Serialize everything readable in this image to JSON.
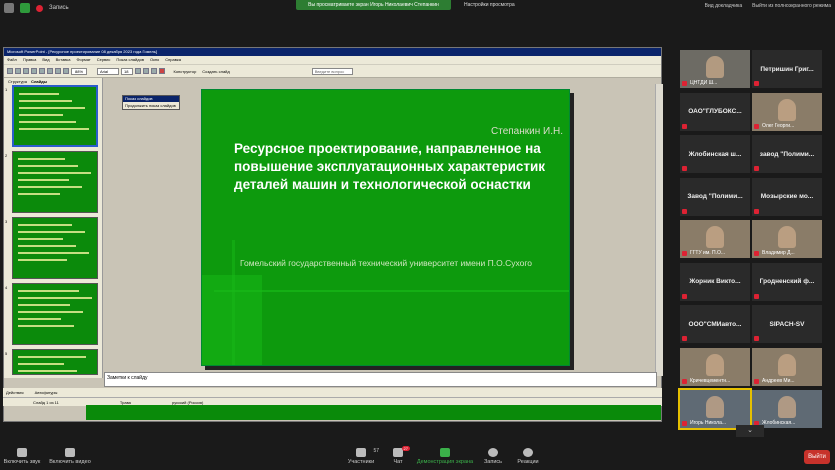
{
  "top": {
    "record_label": "Запись",
    "banner": "Вы просматриваете экран Игорь Николаевич Степанкин",
    "view_options": "Настройки просмотра",
    "gallery_view": "Вид докладчика",
    "exit_fullscreen": "Выйти из полноэкранного режима"
  },
  "ppt": {
    "title": "Microsoft PowerPoint - [Ресурсное проектирование 08 декабря 2023 года Гомель]",
    "menu": [
      "Файл",
      "Правка",
      "Вид",
      "Вставка",
      "Формат",
      "Сервис",
      "Показ слайдов",
      "Окно",
      "Справка"
    ],
    "zoom": "88%",
    "font": "Arial",
    "font_size": "18",
    "design_label": "Конструктор",
    "new_slide_label": "Создать слайд",
    "help_placeholder": "Введите вопрос",
    "tabs": [
      "Структура",
      "Слайды"
    ],
    "floatbar_title": "Показ слайдов",
    "floatbar_item": "Продолжить показ слайдов",
    "notes_placeholder": "Заметки к слайду",
    "draw_label": "Действия",
    "autoshapes_label": "Автофигуры",
    "status_slide": "Слайд 1 из 11",
    "status_design": "Трава",
    "status_lang": "русский (Россия)"
  },
  "slide": {
    "author": "Степанкин И.Н.",
    "title": "Ресурсное проектирование, направленное на повышение эксплуатационных характеристик деталей машин и технологической оснастки",
    "subtitle": "Гомельский государственный технический университет имени П.О.Сухого"
  },
  "thumbnails": [
    {
      "num": "1"
    },
    {
      "num": "2"
    },
    {
      "num": "3"
    },
    {
      "num": "4"
    },
    {
      "num": "5"
    }
  ],
  "participants": [
    {
      "label": "",
      "name": "ЦНТДИ Ш..."
    },
    {
      "label": "Петришин Григ...",
      "name": ""
    },
    {
      "label": "ОАО\"ГЛУБОКС...",
      "name": ""
    },
    {
      "label": "",
      "name": "Олег Георги..."
    },
    {
      "label": "Жлобинская ш...",
      "name": ""
    },
    {
      "label": "завод \"Полими...",
      "name": ""
    },
    {
      "label": "Завод \"Полими...",
      "name": ""
    },
    {
      "label": "Мозырские мо...",
      "name": ""
    },
    {
      "label": "",
      "name": "ГГТУ им. П.О..."
    },
    {
      "label": "",
      "name": "Владимир Д..."
    },
    {
      "label": "Жорник Викто...",
      "name": ""
    },
    {
      "label": "Гродненский ф...",
      "name": ""
    },
    {
      "label": "ООО\"СМИавто...",
      "name": ""
    },
    {
      "label": "SIPACH-SV",
      "name": ""
    },
    {
      "label": "",
      "name": "Кричевцементн..."
    },
    {
      "label": "",
      "name": "Андреев Ми..."
    },
    {
      "label": "",
      "name": "Игорь Никола..."
    },
    {
      "label": "",
      "name": "Жлобинская..."
    }
  ],
  "bottom": {
    "mute": "Включить звук",
    "video": "Включить видео",
    "participants": "Участники",
    "participants_count": "57",
    "chat": "Чат",
    "chat_badge": "27",
    "share": "Демонстрация экрана",
    "record": "Запись",
    "reactions": "Реакции",
    "leave": "Выйти"
  },
  "colors": {
    "slide_green": "#0d9a0d",
    "banner_green": "#2d7d32",
    "leave_red": "#c7322b",
    "active_speaker": "#e6c000"
  }
}
